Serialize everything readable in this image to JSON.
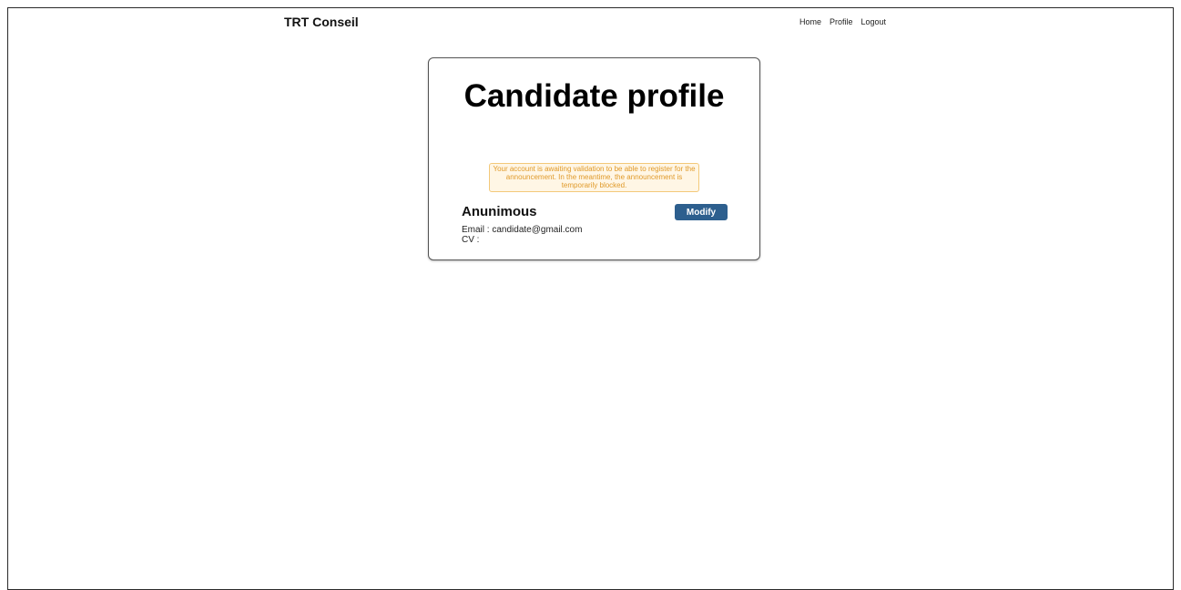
{
  "header": {
    "brand": "TRT Conseil",
    "nav": [
      {
        "label": "Home"
      },
      {
        "label": "Profile"
      },
      {
        "label": "Logout"
      }
    ]
  },
  "profile": {
    "title": "Candidate profile",
    "alert": "Your account is awaiting validation to be able to register for the announcement. In the meantime, the announcement is temporarily blocked.",
    "name": "Anunimous",
    "modify_label": "Modify",
    "email_label": "Email",
    "email_value": "candidate@gmail.com",
    "cv_label": "CV",
    "cv_value": ""
  },
  "colors": {
    "button": "#2d5f8e",
    "alert_text": "#e09a2a",
    "alert_border": "#f3c97a",
    "alert_bg": "#fff6e5"
  }
}
